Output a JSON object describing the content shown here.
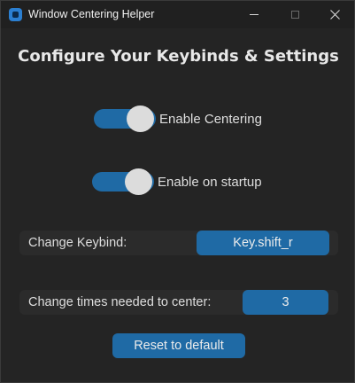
{
  "window": {
    "title": "Window Centering Helper",
    "icon": "app-window-icon",
    "controls": {
      "minimize_icon": "minimize-icon",
      "maximize_icon": "maximize-icon",
      "close_symbol": "✕"
    }
  },
  "main": {
    "heading": "Configure Your Keybinds & Settings",
    "toggles": [
      {
        "label": "Enable Centering",
        "on": true
      },
      {
        "label": "Enable on startup",
        "on": true
      }
    ],
    "keybind": {
      "label": "Change Keybind:",
      "value": "Key.shift_r"
    },
    "times": {
      "label": "Change times needed to center:",
      "value": "3"
    },
    "reset_label": "Reset to default"
  },
  "colors": {
    "accent": "#1f6aa5",
    "background": "#242424",
    "titlebar": "#202020",
    "row_background": "#2b2b2b",
    "knob": "#dcdcdc"
  }
}
